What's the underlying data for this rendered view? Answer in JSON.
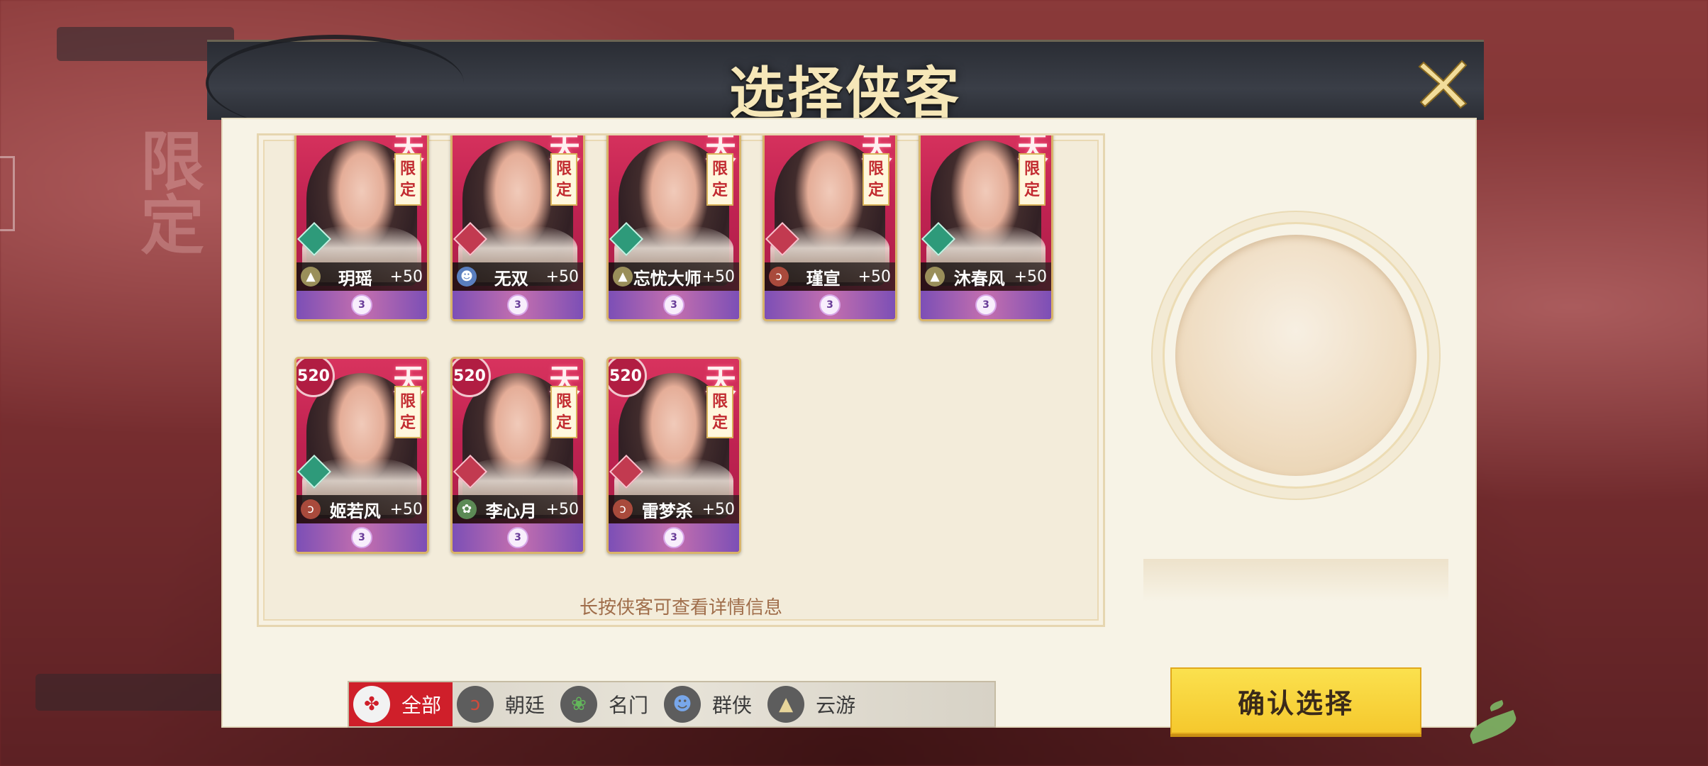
{
  "dialog": {
    "title": "选择侠客",
    "hint": "长按侠客可查看详情信息",
    "confirm_label": "确认选择"
  },
  "heroes": [
    {
      "name": "玥瑶",
      "bonus": "+50",
      "faction": "yun",
      "element": "green",
      "stars": "3"
    },
    {
      "name": "无双",
      "bonus": "+50",
      "faction": "qun",
      "element": "red",
      "stars": "3"
    },
    {
      "name": "忘忧大师",
      "bonus": "+50",
      "faction": "yun",
      "element": "green",
      "stars": "3"
    },
    {
      "name": "瑾宣",
      "bonus": "+50",
      "faction": "chao",
      "element": "red",
      "stars": "3"
    },
    {
      "name": "沐春风",
      "bonus": "+50",
      "faction": "yun",
      "element": "green",
      "stars": "3"
    },
    {
      "name": "姬若风",
      "bonus": "+50",
      "faction": "chao",
      "element": "green",
      "stars": "3",
      "level": "520"
    },
    {
      "name": "李心月",
      "bonus": "+50",
      "faction": "ming",
      "element": "red",
      "stars": "3",
      "level": "520"
    },
    {
      "name": "雷梦杀",
      "bonus": "+50",
      "faction": "chao",
      "element": "red",
      "stars": "3",
      "level": "520"
    }
  ],
  "card_labels": {
    "tian": "天",
    "limited_1": "限",
    "limited_2": "定"
  },
  "filters": [
    {
      "label": "全部",
      "icon": "all-faction-icon",
      "active": true
    },
    {
      "label": "朝廷",
      "icon": "court-faction-icon",
      "active": false
    },
    {
      "label": "名门",
      "icon": "sect-faction-icon",
      "active": false
    },
    {
      "label": "群侠",
      "icon": "heroes-faction-icon",
      "active": false
    },
    {
      "label": "云游",
      "icon": "wanderer-faction-icon",
      "active": false
    }
  ],
  "colors": {
    "card_red": "#c12352",
    "confirm_yellow": "#f5c82d",
    "active_filter_red": "#cf1f2a",
    "title_gold": "#f6e7b8"
  }
}
